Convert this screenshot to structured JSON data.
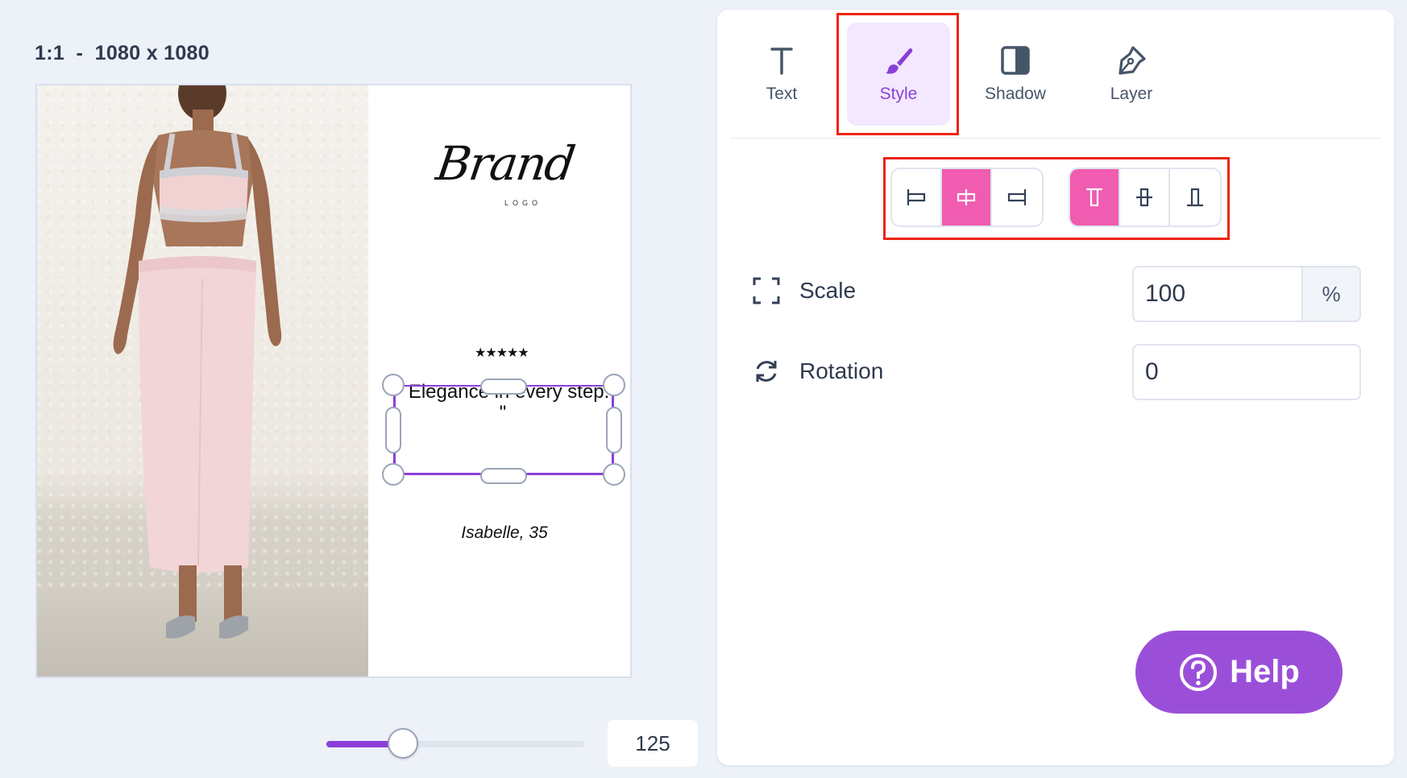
{
  "canvas": {
    "title": "1:1  -  1080 x 1080",
    "brand_text": "Brand",
    "brand_sub": "LOGO",
    "stars": "★★★★★",
    "quote": "\" Elegance in every step. \"",
    "author": "Isabelle, 35"
  },
  "zoom": {
    "value": "125",
    "level_fraction": 0.27
  },
  "tabs": [
    {
      "label": "Text",
      "icon": "text-icon",
      "active": false
    },
    {
      "label": "Style",
      "icon": "brush-icon",
      "active": true
    },
    {
      "label": "Shadow",
      "icon": "shadow-icon",
      "active": false
    },
    {
      "label": "Layer",
      "icon": "pen-icon",
      "active": false
    }
  ],
  "horizontal_align": [
    {
      "name": "align-left",
      "active": false
    },
    {
      "name": "align-center",
      "active": true
    },
    {
      "name": "align-right",
      "active": false
    }
  ],
  "vertical_align": [
    {
      "name": "align-top",
      "active": true
    },
    {
      "name": "align-middle",
      "active": false
    },
    {
      "name": "align-bottom",
      "active": false
    }
  ],
  "properties": {
    "scale_label": "Scale",
    "scale_value": "100",
    "scale_unit": "%",
    "rotation_label": "Rotation",
    "rotation_value": "0"
  },
  "help": {
    "label": "Help"
  },
  "colors": {
    "accent": "#8b3fd9",
    "pink": "#f05cb0",
    "highlight": "#ee2412"
  }
}
